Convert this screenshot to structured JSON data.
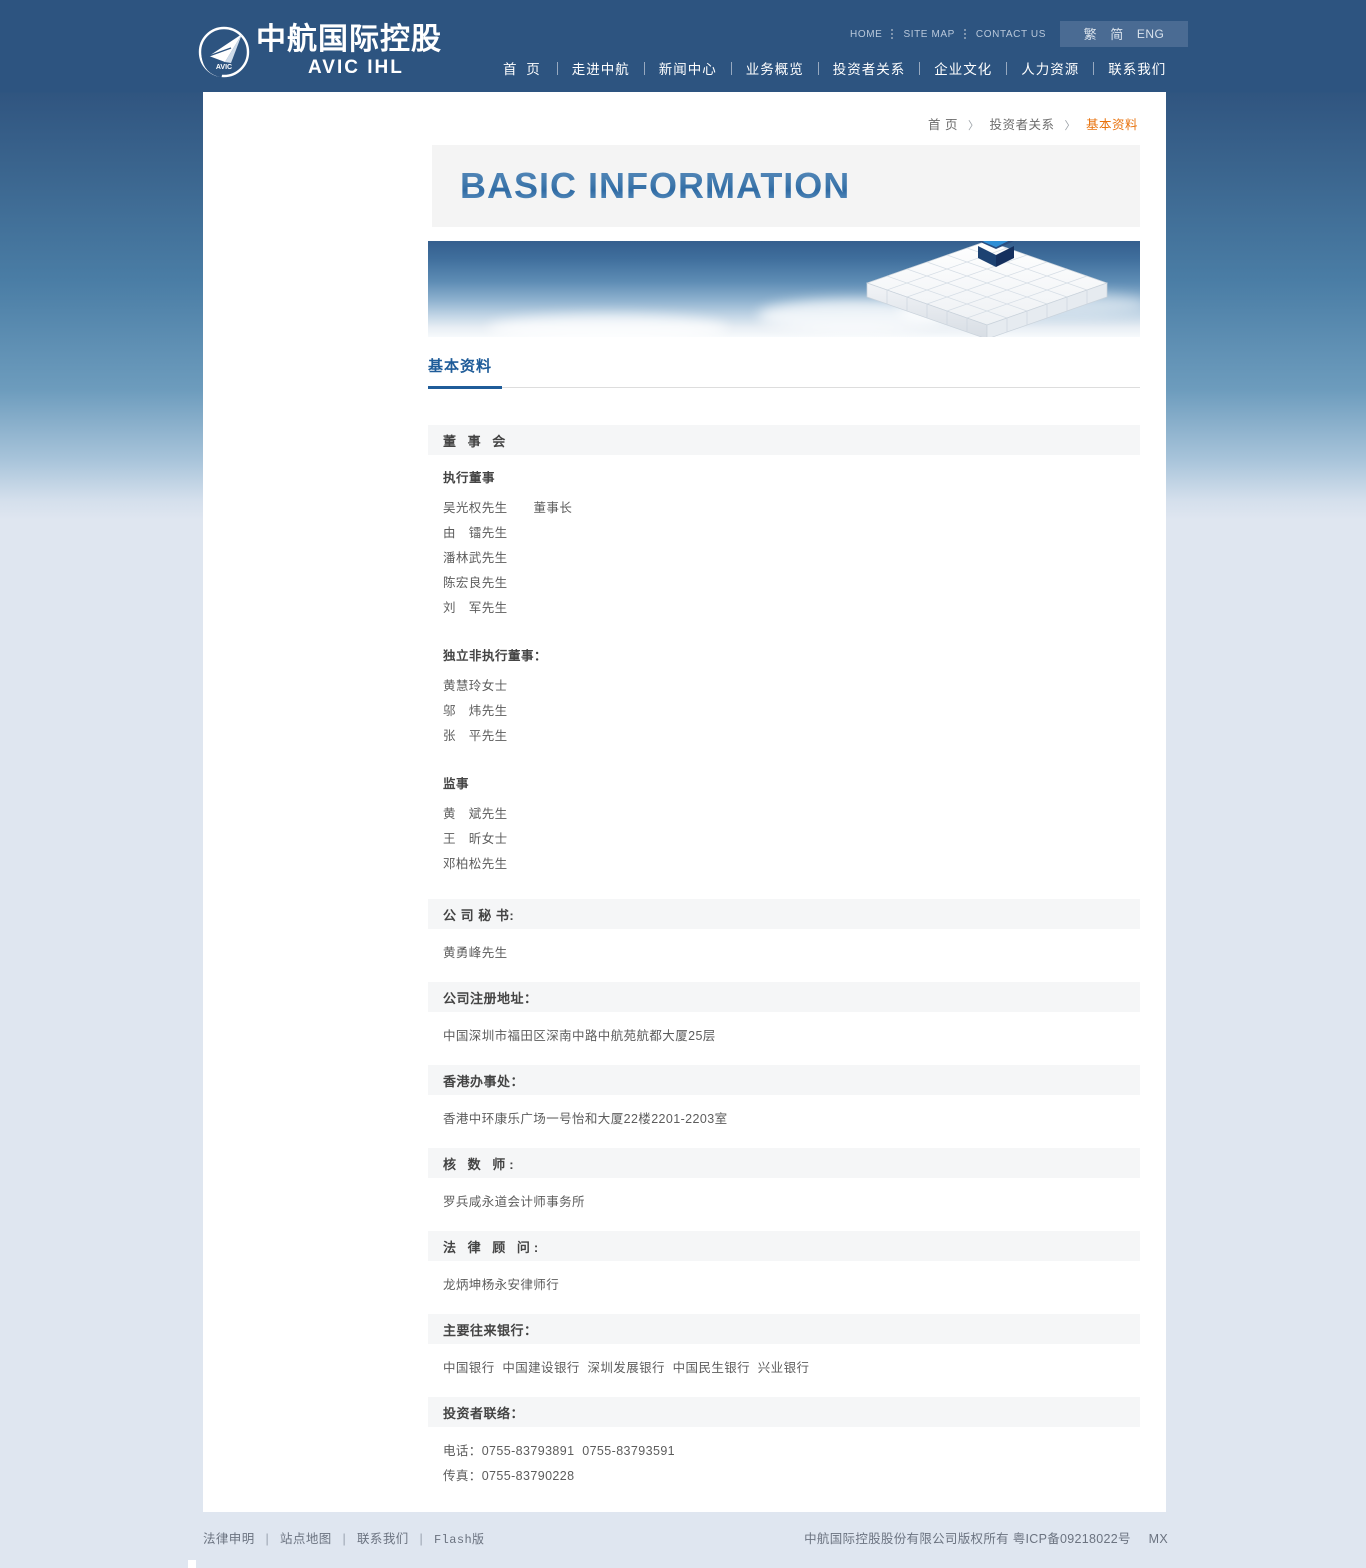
{
  "header": {
    "logo": {
      "icon": "avic-logo-icon",
      "cn": "中航国际控股",
      "en": "AVIC  IHL",
      "mark_text": "AVIC"
    },
    "top_links": [
      {
        "label": "HOME"
      },
      {
        "label": "SITE MAP"
      },
      {
        "label": "CONTACT US"
      }
    ],
    "languages": [
      {
        "label": "繁"
      },
      {
        "label": "简"
      },
      {
        "label": "ENG"
      }
    ],
    "nav": [
      {
        "label": "首 页"
      },
      {
        "label": "走进中航"
      },
      {
        "label": "新闻中心"
      },
      {
        "label": "业务概览"
      },
      {
        "label": "投资者关系"
      },
      {
        "label": "企业文化"
      },
      {
        "label": "人力资源"
      },
      {
        "label": "联系我们"
      }
    ]
  },
  "breadcrumb": {
    "home": "首 页",
    "section": "投资者关系",
    "current": "基本资料",
    "arrow": "〉"
  },
  "page": {
    "big_title": "BASIC  INFORMATION",
    "tab_label": "基本资料"
  },
  "sections": [
    {
      "id": "board",
      "header": "董 事 会",
      "header_spaced": true,
      "groups": [
        {
          "title": "执行董事",
          "rows": [
            {
              "name": "吴光权先生",
              "role": "董事长"
            },
            {
              "name": "由　镭先生",
              "role": ""
            },
            {
              "name": "潘林武先生",
              "role": ""
            },
            {
              "name": "陈宏良先生",
              "role": ""
            },
            {
              "name": "刘　军先生",
              "role": ""
            }
          ]
        },
        {
          "title": "独立非执行董事：",
          "rows": [
            {
              "name": "黄慧玲女士",
              "role": ""
            },
            {
              "name": "邬　炜先生",
              "role": ""
            },
            {
              "name": "张　平先生",
              "role": ""
            }
          ]
        },
        {
          "title": "监事",
          "rows": [
            {
              "name": "黄　斌先生",
              "role": ""
            },
            {
              "name": "王　昕女士",
              "role": ""
            },
            {
              "name": "邓柏松先生",
              "role": ""
            }
          ]
        }
      ]
    },
    {
      "id": "company-secretary",
      "header": "公 司 秘 书:",
      "header_spaced": false,
      "lines": [
        "黄勇峰先生"
      ]
    },
    {
      "id": "registered-address",
      "header": "公司注册地址：",
      "header_spaced": false,
      "lines": [
        "中国深圳市福田区深南中路中航苑航都大厦25层"
      ]
    },
    {
      "id": "hk-office",
      "header": "香港办事处：",
      "header_spaced": false,
      "lines": [
        "香港中环康乐广场一号怡和大厦22楼2201-2203室"
      ]
    },
    {
      "id": "auditor",
      "header": "核 数 师:",
      "header_spaced": false,
      "lines": [
        "罗兵咸永道会计师事务所"
      ]
    },
    {
      "id": "legal-advisor",
      "header": "法 律 顾 问:",
      "header_spaced": false,
      "lines": [
        "龙炳坤杨永安律师行"
      ]
    },
    {
      "id": "principal-banks",
      "header": "主要往来银行：",
      "header_spaced": false,
      "lines": [
        "中国银行  中国建设银行  深圳发展银行  中国民生银行  兴业银行"
      ]
    },
    {
      "id": "investor-contact",
      "header": "投资者联络：",
      "header_spaced": false,
      "lines": [
        "电话：0755-83793891  0755-83793591",
        "传真：0755-83790228"
      ]
    }
  ],
  "footer": {
    "links": [
      {
        "label": "法律申明"
      },
      {
        "label": "站点地图"
      },
      {
        "label": "联系我们"
      },
      {
        "label": "Flash版"
      }
    ],
    "separator": "|",
    "copyright": "中航国际控股股份有限公司版权所有 粤ICP备09218022号",
    "mx": "MX"
  },
  "colors": {
    "header_blue": "#2d5480",
    "accent_orange": "#e8720c",
    "tab_blue": "#1f5c99",
    "footer_bg": "#dfe6f0"
  }
}
